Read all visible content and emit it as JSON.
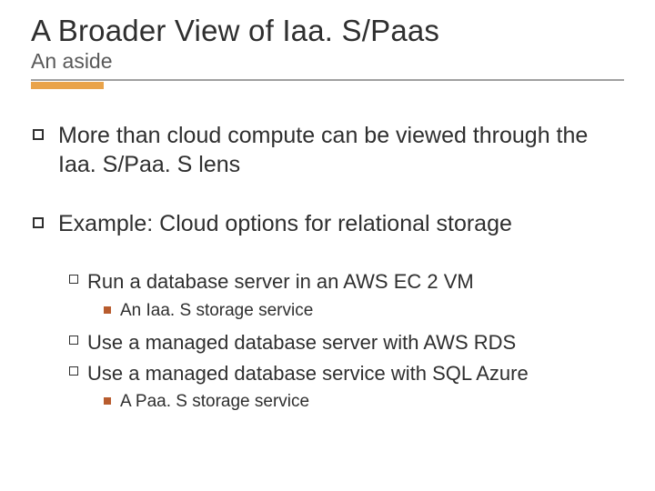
{
  "title": "A Broader View of Iaa. S/Paas",
  "subtitle": "An aside",
  "bullets": {
    "p1": "More than cloud compute can be viewed through the Iaa. S/Paa. S lens",
    "p2": "Example: Cloud options for relational storage",
    "p2_sub": {
      "s1": "Run a database server in an AWS EC 2 VM",
      "s1_sub": "An Iaa. S storage service",
      "s2": "Use a managed database server with AWS RDS",
      "s3": "Use a managed database service with SQL Azure",
      "s3_sub": "A Paa. S storage service"
    }
  }
}
